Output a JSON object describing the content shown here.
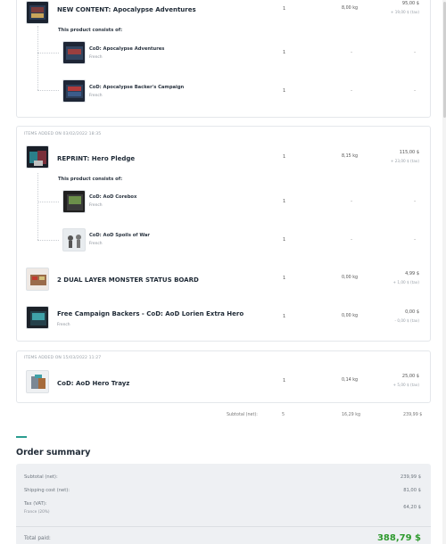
{
  "card1": {
    "main": {
      "name": "NEW CONTENT: Apocalypse Adventures",
      "qty": "1",
      "weight": "8,00 kg",
      "price": "95,00 $",
      "tax": "+ 19,00 $ (tax)"
    },
    "consists_label": "This product consists of:",
    "subs": [
      {
        "name": "CoD: Apocalypse Adventures",
        "lang": "French",
        "qty": "1",
        "weight": "-",
        "price": "-"
      },
      {
        "name": "CoD: Apocalypse Backer's Campaign",
        "lang": "French",
        "qty": "1",
        "weight": "-",
        "price": "-"
      }
    ]
  },
  "card2": {
    "group_label": "ITEMS ADDED ON 03/02/2022 18:35",
    "main": {
      "name": "REPRINT: Hero Pledge",
      "qty": "1",
      "weight": "8,15 kg",
      "price": "115,00 $",
      "tax": "+ 23,00 $ (tax)"
    },
    "consists_label": "This product consists of:",
    "subs": [
      {
        "name": "CoD: AoD Corebox",
        "lang": "French",
        "qty": "1",
        "weight": "-",
        "price": "-"
      },
      {
        "name": "CoD: AoD Spoils of War",
        "lang": "French",
        "qty": "1",
        "weight": "-",
        "price": "-"
      }
    ],
    "item3": {
      "name": "2 DUAL LAYER MONSTER STATUS BOARD",
      "qty": "1",
      "weight": "0,00 kg",
      "price": "4,99 $",
      "tax": "+ 1,00 $ (tax)"
    },
    "item4": {
      "name": "Free Campaign Backers - CoD: AoD Lorien Extra Hero",
      "lang": "French",
      "qty": "1",
      "weight": "0,00 kg",
      "price": "0,00 $",
      "tax": "- 0,00 $ (tax)"
    }
  },
  "card3": {
    "group_label": "ITEMS ADDED ON 15/03/2022 11:27",
    "main": {
      "name": "CoD: AoD Hero Trayz",
      "qty": "1",
      "weight": "0,14 kg",
      "price": "25,00 $",
      "tax": "+ 5,00 $ (tax)"
    }
  },
  "subtotal": {
    "label": "Subtotal (net):",
    "qty": "5",
    "weight": "16,29 kg",
    "price": "239,99 $"
  },
  "summary": {
    "title": "Order summary",
    "subtotal_label": "Subtotal (net):",
    "subtotal_value": "239,99 $",
    "shipping_label": "Shipping cost (net):",
    "shipping_value": "81,00 $",
    "tax_label": "Tax (VAT):",
    "tax_sub": "France (20%)",
    "tax_value": "64,20 $",
    "total_label": "Total paid:",
    "total_value": "388,79 $",
    "total_color": "#2e9a2e"
  }
}
